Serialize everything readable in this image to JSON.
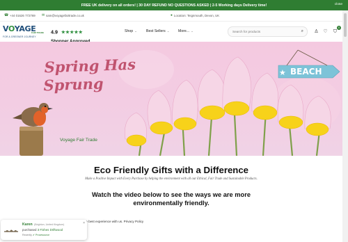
{
  "announcement": {
    "text": "FREE UK delivery on all orders! | 30 DAY REFUND NO QUESTIONS ASKED | 2-5 Working days Delivery time!",
    "close": "close"
  },
  "contact": {
    "phone": "+44 01626 772769",
    "email": "sam@voyagefairtrade.co.uk",
    "location": "Location: Teignmouth, Devon, UK"
  },
  "brand": {
    "name_part1": "V",
    "name_part2": "O",
    "name_part3": "YAGE",
    "fair": "FAIR TRADE",
    "tagline": "FOR A GREENER JOURNEY"
  },
  "rating": {
    "score": "4.9",
    "stars": "★★★★★",
    "label": "Shopper Approved"
  },
  "nav": {
    "shop": "Shop",
    "best_sellers": "Best Sellers",
    "more": "More..."
  },
  "search": {
    "placeholder": "Search for products"
  },
  "cart": {
    "count": "0"
  },
  "hero": {
    "title_line1": "Spring Has",
    "title_line2": "Sprung",
    "sign": "BEACH",
    "brand": "Voyage Fair Trade"
  },
  "content": {
    "heading": "Eco Friendly Gifts with a Difference",
    "subheading": "Make a Positive Impact with Every Purchase by helping the environment with all our Ethical, Fair Trade and Sustainable Products.",
    "video_line1": "Watch the video below to see the ways we are more",
    "video_line2": "environmentally friendly."
  },
  "cookie": {
    "text": "This website uses cookies to ensure you get the best experience with us. Privacy Policy"
  },
  "popup": {
    "name": "Karen",
    "location": "(Brighton, United Kingdom)",
    "action": "purchased",
    "product": "3 Fishes Driftwood",
    "time": "Recently",
    "provenance": "Provesource"
  },
  "colors": {
    "brand_green": "#2f7d32",
    "hero_pink": "#f4c9e0",
    "title_rose": "#c0536f"
  }
}
